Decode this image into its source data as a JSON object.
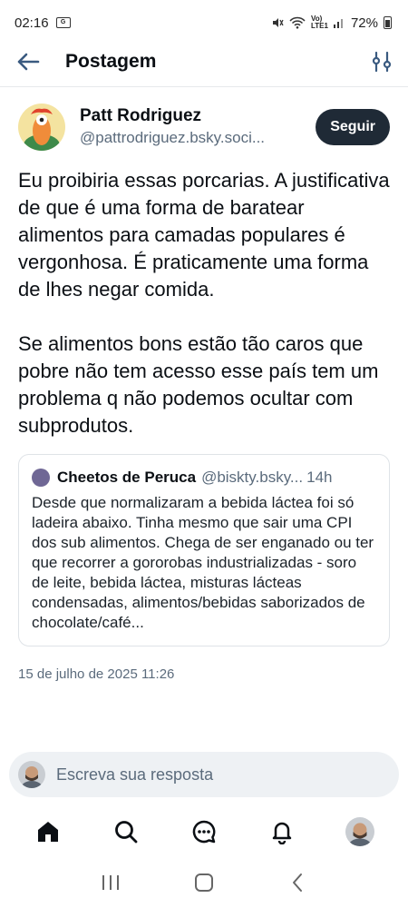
{
  "status_bar": {
    "time": "02:16",
    "battery": "72%",
    "network": "Vo) LTE1"
  },
  "header": {
    "title": "Postagem"
  },
  "post": {
    "author_name": "Patt Rodriguez",
    "author_handle": "@pattrodriguez.bsky.soci...",
    "follow_label": "Seguir",
    "paragraphs": [
      "Eu proibiria essas porcarias. A justificativa de que é uma forma de baratear alimentos para camadas populares é vergonhosa. É praticamente uma forma de lhes negar comida.",
      "Se alimentos bons estão tão caros que pobre não tem acesso esse país tem um problema q não podemos ocultar com subprodutos."
    ],
    "timestamp": "15 de julho de 2025 11:26"
  },
  "quote": {
    "author_name": "Cheetos de Peruca",
    "author_handle": "@biskty.bsky...",
    "age": "14h",
    "text": "Desde que normalizaram a bebida láctea foi só ladeira abaixo. Tinha mesmo que sair uma CPI dos sub alimentos. Chega de ser enganado ou ter que recorrer a gororobas industrializadas - soro de leite, bebida láctea, misturas lácteas condensadas, alimentos/bebidas saborizados de chocolate/café..."
  },
  "reply": {
    "placeholder": "Escreva sua resposta"
  },
  "nav": {
    "items": [
      "home-icon",
      "search-icon",
      "chat-icon",
      "notifications-icon",
      "profile-avatar"
    ]
  },
  "colors": {
    "follow_bg": "#1f2a36",
    "muted_text": "#5b6b7c",
    "quote_avatar": "#6f6795",
    "reply_bg": "#eef1f4"
  }
}
